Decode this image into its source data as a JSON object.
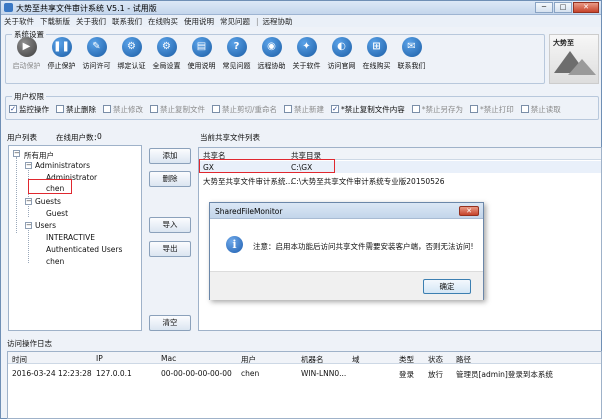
{
  "window": {
    "title": "大势至共享文件审计系统 V5.1 - 试用版",
    "min": "─",
    "max": "□",
    "close": "✕"
  },
  "menu": {
    "items": [
      "关于软件",
      "下载新版",
      "关于我们",
      "联系我们",
      "在线购买",
      "使用说明",
      "常见问题"
    ],
    "separator": "|",
    "remote": "远程协助"
  },
  "system_settings": {
    "label": "系统设置",
    "tools": [
      {
        "label": "启动保护",
        "icon": "play-icon",
        "glyph": "▶",
        "enabled": false
      },
      {
        "label": "停止保护",
        "icon": "pause-icon",
        "glyph": "❚❚",
        "enabled": true
      },
      {
        "label": "访问许可",
        "icon": "license-icon",
        "glyph": "✎",
        "enabled": true
      },
      {
        "label": "绑定认证",
        "icon": "bind-icon",
        "glyph": "⚙",
        "enabled": true
      },
      {
        "label": "全局设置",
        "icon": "settings-icon",
        "glyph": "⚙",
        "enabled": true
      },
      {
        "label": "使用说明",
        "icon": "manual-icon",
        "glyph": "▤",
        "enabled": true
      },
      {
        "label": "常见问题",
        "icon": "question-icon",
        "glyph": "?",
        "enabled": true
      },
      {
        "label": "远程协助",
        "icon": "remote-icon",
        "glyph": "◉",
        "enabled": true
      },
      {
        "label": "关于软件",
        "icon": "about-icon",
        "glyph": "✦",
        "enabled": true
      },
      {
        "label": "访问官网",
        "icon": "website-icon",
        "glyph": "◐",
        "enabled": true
      },
      {
        "label": "在线购买",
        "icon": "cart-icon",
        "glyph": "⊞",
        "enabled": true
      },
      {
        "label": "联系我们",
        "icon": "contact-icon",
        "glyph": "✉",
        "enabled": true
      }
    ],
    "logo_text": "大势至"
  },
  "permissions": {
    "label": "用户权限",
    "items": [
      {
        "label": "监控操作",
        "checked": true,
        "enabled": true
      },
      {
        "label": "禁止删除",
        "checked": false,
        "enabled": true
      },
      {
        "label": "禁止修改",
        "checked": false,
        "enabled": false
      },
      {
        "label": "禁止复制文件",
        "checked": false,
        "enabled": false
      },
      {
        "label": "禁止剪切/重命名",
        "checked": false,
        "enabled": false
      },
      {
        "label": "禁止新建",
        "checked": false,
        "enabled": false
      },
      {
        "label": "*禁止复制文件内容",
        "checked": true,
        "enabled": true
      },
      {
        "label": "*禁止另存为",
        "checked": false,
        "enabled": false
      },
      {
        "label": "*禁止打印",
        "checked": false,
        "enabled": false
      },
      {
        "label": "禁止读取",
        "checked": false,
        "enabled": false
      }
    ]
  },
  "users": {
    "label": "用户列表",
    "online_label": "在线用户数：",
    "online_count": "0",
    "root": "所有用户",
    "groups": [
      {
        "name": "Administrators",
        "members": [
          "Administrator",
          "chen"
        ]
      },
      {
        "name": "Guests",
        "members": [
          "Guest"
        ]
      },
      {
        "name": "Users",
        "members": [
          "INTERACTIVE",
          "Authenticated Users",
          "chen"
        ]
      }
    ],
    "expand_minus": "−"
  },
  "actions": {
    "add": "添加",
    "delete": "删除",
    "import": "导入",
    "export": "导出",
    "clear": "清空"
  },
  "shared_files": {
    "label": "当前共享文件列表",
    "columns": [
      "共享名",
      "共享目录"
    ],
    "rows": [
      [
        "GX",
        "C:\\GX"
      ],
      [
        "大势至共享文件审计系统...",
        "C:\\大势至共享文件审计系统专业版20150526"
      ]
    ]
  },
  "log": {
    "label": "访问操作日志",
    "columns": [
      "时间",
      "IP",
      "Mac",
      "用户",
      "机器名",
      "域",
      "类型",
      "状态",
      "路径"
    ],
    "rows": [
      [
        "2016-03-24 12:23:28",
        "127.0.0.1",
        "00-00-00-00-00-00",
        "chen",
        "WIN-LNN0...",
        "",
        "登录",
        "放行",
        "管理员[admin]登录到本系统"
      ]
    ]
  },
  "dialog": {
    "title": "SharedFileMonitor",
    "close": "✕",
    "icon_glyph": "i",
    "message": "注意：启用本功能后访问共享文件需要安装客户端，否则无法访问!",
    "ok": "确定"
  }
}
